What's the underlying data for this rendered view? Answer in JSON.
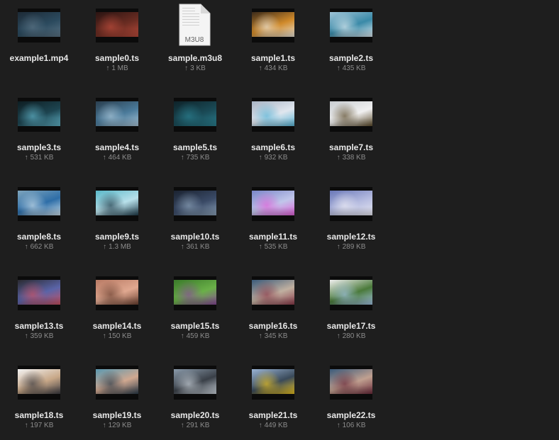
{
  "files": [
    {
      "name": "example1.mp4",
      "size": "",
      "kind": "video",
      "colors": [
        "#1d2a36",
        "#2b4a5e",
        "#5b7384"
      ]
    },
    {
      "name": "sample0.ts",
      "size": "1 MB",
      "kind": "video",
      "colors": [
        "#2a1412",
        "#6a2c22",
        "#b84a3a"
      ]
    },
    {
      "name": "sample.m3u8",
      "size": "3 KB",
      "kind": "document",
      "doc_label": "M3U8"
    },
    {
      "name": "sample1.ts",
      "size": "434 KB",
      "kind": "video",
      "colors": [
        "#3a2a1a",
        "#d08a2a",
        "#e8e2d6"
      ]
    },
    {
      "name": "sample2.ts",
      "size": "435 KB",
      "kind": "video",
      "colors": [
        "#9ec3d6",
        "#3a8aa8",
        "#dce9ef"
      ]
    },
    {
      "name": "sample3.ts",
      "size": "531 KB",
      "kind": "video",
      "colors": [
        "#0e1d22",
        "#1d4450",
        "#5fb0c4"
      ]
    },
    {
      "name": "sample4.ts",
      "size": "464 KB",
      "kind": "video",
      "colors": [
        "#2a3e4e",
        "#4a7a9a",
        "#a8c4d6"
      ]
    },
    {
      "name": "sample5.ts",
      "size": "735 KB",
      "kind": "video",
      "colors": [
        "#0e2228",
        "#1a4a56",
        "#2a7e8e"
      ]
    },
    {
      "name": "sample6.ts",
      "size": "932 KB",
      "kind": "video",
      "colors": [
        "#a8b4c4",
        "#e0e6ee",
        "#58b4d6"
      ]
    },
    {
      "name": "sample7.ts",
      "size": "338 KB",
      "kind": "video",
      "colors": [
        "#c8ccd0",
        "#f0f0f0",
        "#5a4a2a"
      ]
    },
    {
      "name": "sample8.ts",
      "size": "662 KB",
      "kind": "video",
      "colors": [
        "#7ea4bc",
        "#2e6ea8",
        "#c8dce8"
      ]
    },
    {
      "name": "sample9.ts",
      "size": "1.3 MB",
      "kind": "video",
      "colors": [
        "#5ab8c8",
        "#b8e0ea",
        "#1e3a48"
      ]
    },
    {
      "name": "sample10.ts",
      "size": "361 KB",
      "kind": "video",
      "colors": [
        "#1a2230",
        "#3a4a66",
        "#8aa0b6"
      ]
    },
    {
      "name": "sample11.ts",
      "size": "535 KB",
      "kind": "video",
      "colors": [
        "#7a86c8",
        "#c0c6ea",
        "#e060d8"
      ]
    },
    {
      "name": "sample12.ts",
      "size": "289 KB",
      "kind": "video",
      "colors": [
        "#6a78b8",
        "#b6bce0",
        "#e8e8f2"
      ]
    },
    {
      "name": "sample13.ts",
      "size": "359 KB",
      "kind": "video",
      "colors": [
        "#2a2a30",
        "#5a64a8",
        "#c85060"
      ]
    },
    {
      "name": "sample14.ts",
      "size": "150 KB",
      "kind": "video",
      "colors": [
        "#b87a64",
        "#e0a890",
        "#6a4030"
      ]
    },
    {
      "name": "sample15.ts",
      "size": "459 KB",
      "kind": "video",
      "colors": [
        "#3a7a2a",
        "#6ab048",
        "#8a4a9a"
      ]
    },
    {
      "name": "sample16.ts",
      "size": "345 KB",
      "kind": "video",
      "colors": [
        "#3a5a7a",
        "#c0b0a0",
        "#8a3a4a"
      ]
    },
    {
      "name": "sample17.ts",
      "size": "280 KB",
      "kind": "video",
      "colors": [
        "#f0f0f0",
        "#4a7a3a",
        "#a0c0e0"
      ]
    },
    {
      "name": "sample18.ts",
      "size": "197 KB",
      "kind": "video",
      "colors": [
        "#f2f2f2",
        "#c8a888",
        "#3a3a40"
      ]
    },
    {
      "name": "sample19.ts",
      "size": "129 KB",
      "kind": "video",
      "colors": [
        "#5a98b0",
        "#d0a890",
        "#2a3a48"
      ]
    },
    {
      "name": "sample20.ts",
      "size": "291 KB",
      "kind": "video",
      "colors": [
        "#8a9aaa",
        "#3a4048",
        "#c8d0d8"
      ]
    },
    {
      "name": "sample21.ts",
      "size": "449 KB",
      "kind": "video",
      "colors": [
        "#9ab4d4",
        "#3a4a5a",
        "#e8c020"
      ]
    },
    {
      "name": "sample22.ts",
      "size": "106 KB",
      "kind": "video",
      "colors": [
        "#3a5a7a",
        "#c0a090",
        "#6a2a3a"
      ]
    }
  ],
  "upload_arrow": "↑"
}
